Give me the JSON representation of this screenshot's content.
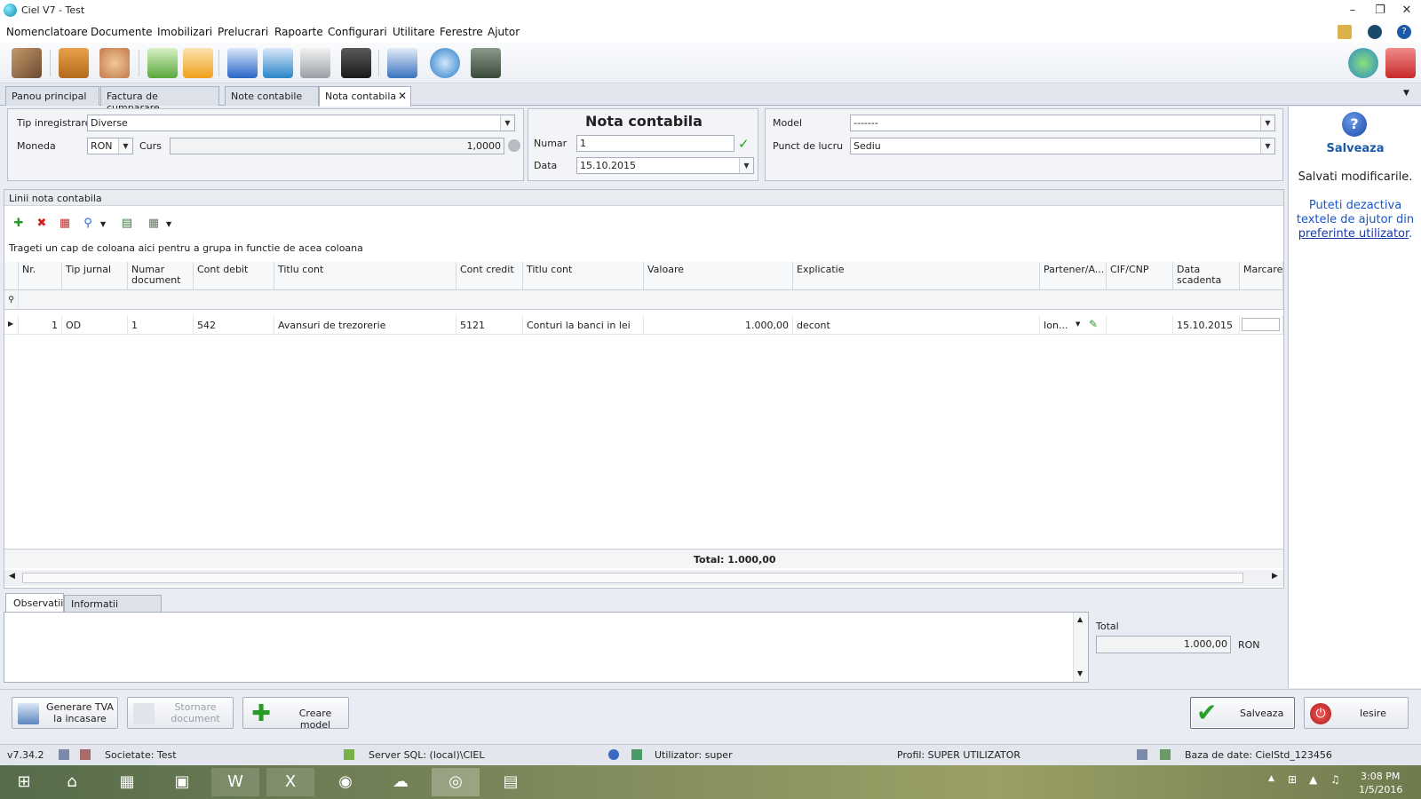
{
  "window": {
    "title": "Ciel V7 - Test"
  },
  "menu": [
    "Nomenclatoare",
    "Documente",
    "Imobilizari",
    "Prelucrari",
    "Rapoarte",
    "Configurari",
    "Utilitare",
    "Ferestre",
    "Ajutor"
  ],
  "tabs": [
    {
      "label": "Panou principal"
    },
    {
      "label": "Factura de cumparare"
    },
    {
      "label": "Note contabile"
    },
    {
      "label": "Nota contabila",
      "closable": true
    }
  ],
  "form": {
    "tip_label": "Tip inregistrare",
    "tip_value": "Diverse",
    "moneda_label": "Moneda",
    "moneda_value": "RON",
    "curs_label": "Curs",
    "curs_value": "1,0000",
    "heading": "Nota contabila",
    "numar_label": "Numar",
    "numar_value": "1",
    "data_label": "Data",
    "data_value": "15.10.2015",
    "model_label": "Model",
    "model_value": "-------",
    "punct_label": "Punct de lucru",
    "punct_value": "Sediu"
  },
  "grid": {
    "section_title": "Linii nota contabila",
    "group_hint": "Trageti un cap de coloana aici pentru a grupa in functie de acea coloana",
    "columns": [
      "Nr.",
      "Tip jurnal",
      "Numar document",
      "Cont debit",
      "Titlu cont",
      "Cont credit",
      "Titlu cont",
      "Valoare",
      "Explicatie",
      "Partener/A...",
      "CIF/CNP",
      "Data scadenta",
      "Marcare"
    ],
    "rows": [
      {
        "nr": "1",
        "tip": "OD",
        "numar": "1",
        "debit": "542",
        "titlu_debit": "Avansuri de trezorerie",
        "credit": "5121",
        "titlu_credit": "Conturi la banci in lei",
        "valoare": "1.000,00",
        "explicatie": "decont",
        "partener": "Ion...",
        "cif": "",
        "scadenta": "15.10.2015"
      }
    ],
    "total": "Total: 1.000,00"
  },
  "notes": {
    "tabs": [
      "Observatii",
      "Informatii aditionale"
    ],
    "total_label": "Total",
    "total_value": "1.000,00",
    "currency": "RON"
  },
  "help": {
    "title": "Salveaza",
    "text1": "Salvati modificarile.",
    "text2": "Puteti dezactiva textele de ajutor din",
    "link": "preferinte utilizator",
    "tail": "."
  },
  "buttons": {
    "tva": "Generare TVA la incasare",
    "stornare": "Stornare document",
    "model": "Creare model",
    "save": "Salveaza",
    "exit": "Iesire"
  },
  "status": {
    "version": "v7.34.2",
    "company": "Societate: Test",
    "server": "Server SQL: (local)\\CIEL",
    "user": "Utilizator: super",
    "profile": "Profil: SUPER UTILIZATOR",
    "db": "Baza de date: CielStd_123456"
  },
  "taskbar": {
    "time": "3:08 PM",
    "date": "1/5/2016"
  },
  "colors": {
    "accent": "#1a5aa8",
    "help_blue": "#1a56c8",
    "grid_border": "#b9c0cc"
  }
}
